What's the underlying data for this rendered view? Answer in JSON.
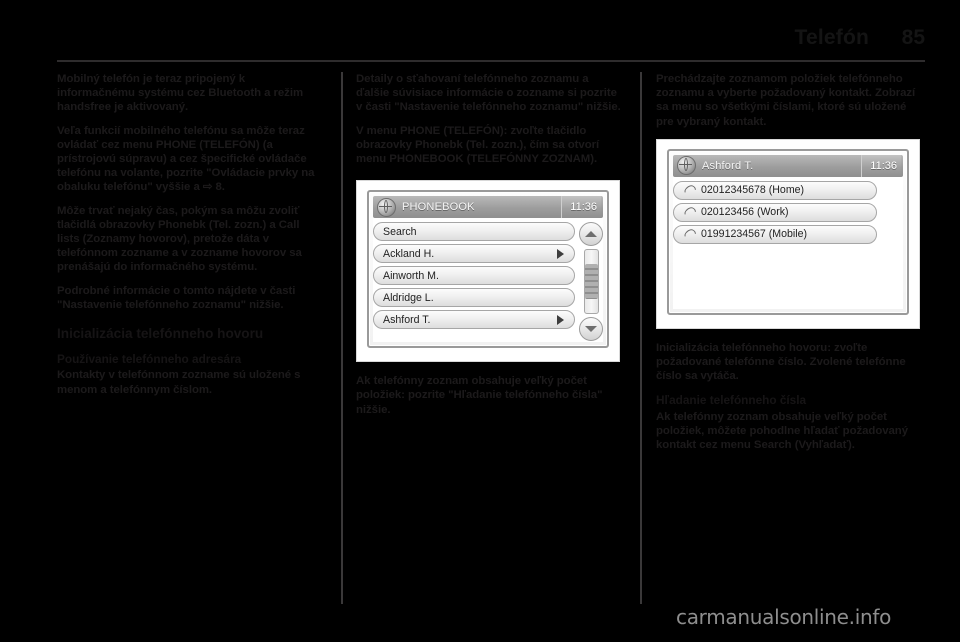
{
  "header": {
    "title": "Telefón",
    "page_number": "85"
  },
  "column1": {
    "paragraphs": [
      "Mobilný telefón je teraz pripojený k informačnému systému cez Bluetooth a režim handsfree je aktivovaný.",
      "Veľa funkcií mobilného telefónu sa môže teraz ovládať cez menu PHONE (TELEFÓN) (a prístrojovú súpravu) a cez špecifické ovládače telefónu na volante, pozrite \"Ovládacie prvky na obaluku telefónu\" vyššie a ⇨ 8.",
      "Môže trvať nejaký čas, pokým sa môžu zvoliť tlačidlá obrazovky Phonebk (Tel. zozn.) a Call lists (Zoznamy hovorov), pretože dáta v telefónnom zozname a v zozname hovorov sa prenášajú do informačného systému.",
      "Podrobné informácie o tomto nájdete v časti \"Nastavenie telefónneho zoznamu\" nižšie."
    ],
    "section_heading": "Inicializácia telefónneho hovoru",
    "sub_heading": "Používanie telefónneho adresára",
    "sub_paragraph": "Kontakty v telefónnom zozname sú uložené s menom a telefónnym číslom."
  },
  "column2": {
    "paragraphs": [
      "Detaily o sťahovaní telefónneho zoznamu a ďalšie súvisiace informácie o zozname si pozrite v časti \"Nastavenie telefónneho zoznamu\" nižšie.",
      "V menu PHONE (TELEFÓN): zvoľte tlačidlo obrazovky Phonebk (Tel. zozn.), čím sa otvorí menu PHONEBOOK (TELEFÓNNY ZOZNAM)."
    ],
    "figure": {
      "title": "PHONEBOOK",
      "clock": "11:36",
      "items": [
        {
          "label": "Search",
          "has_arrow": false
        },
        {
          "label": "Ackland H.",
          "has_arrow": true
        },
        {
          "label": "Ainworth M.",
          "has_arrow": false
        },
        {
          "label": "Aldridge L.",
          "has_arrow": false
        },
        {
          "label": "Ashford T.",
          "has_arrow": true
        }
      ]
    },
    "after_figure": "Ak telefónny zoznam obsahuje veľký počet položiek: pozrite \"Hľadanie telefónneho čísla\" nižšie."
  },
  "column3": {
    "paragraphs": [
      "Prechádzajte zoznamom položiek telefónneho zoznamu a vyberte požadovaný kontakt. Zobrazí sa menu so všetkými číslami, ktoré sú uložené pre vybraný kontakt."
    ],
    "figure": {
      "title": "Ashford T.",
      "clock": "11:36",
      "items": [
        {
          "label": "02012345678 (Home)"
        },
        {
          "label": "020123456 (Work)"
        },
        {
          "label": "01991234567 (Mobile)"
        }
      ]
    },
    "after_figure": "Inicializácia telefónneho hovoru: zvoľte požadované telefónne číslo. Zvolené telefónne číslo sa vytáča.",
    "sub_heading": "Hľadanie telefónneho čísla",
    "sub_paragraph": "Ak telefónny zoznam obsahuje veľký počet položiek, môžete pohodlne hľadať požadovaný kontakt cez menu Search (Vyhľadať)."
  },
  "footer": {
    "watermark": "carmanualsonline.info"
  }
}
